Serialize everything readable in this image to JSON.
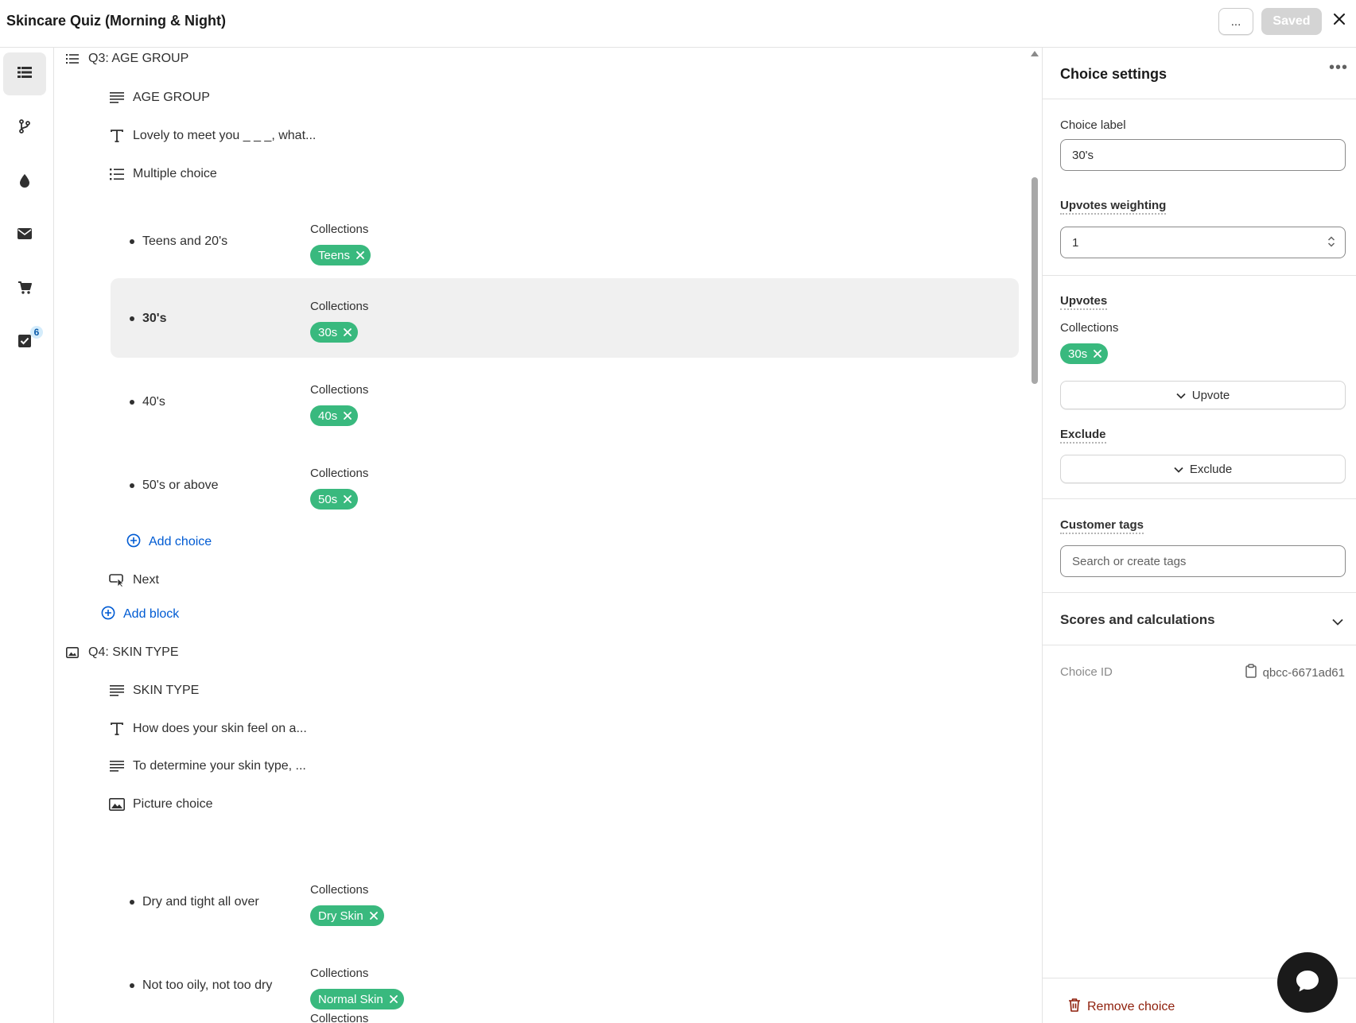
{
  "header": {
    "title": "Skincare Quiz (Morning & Night)",
    "more_label": "...",
    "saved_label": "Saved"
  },
  "rail": {
    "icons": [
      "list-icon",
      "branch-icon",
      "drop-icon",
      "mail-icon",
      "cart-icon",
      "checklist-icon"
    ],
    "badge_count": "6"
  },
  "tree": {
    "q3": {
      "title": "Q3: AGE GROUP",
      "blocks": {
        "heading": "AGE GROUP",
        "text": "Lovely to meet you _ _ _, what...",
        "multiple_choice": "Multiple choice"
      },
      "choices": [
        {
          "label": "Teens and 20's",
          "collections_label": "Collections",
          "tag": "Teens"
        },
        {
          "label": "30's",
          "collections_label": "Collections",
          "tag": "30s"
        },
        {
          "label": "40's",
          "collections_label": "Collections",
          "tag": "40s"
        },
        {
          "label": "50's or above",
          "collections_label": "Collections",
          "tag": "50s"
        }
      ],
      "add_choice": "Add choice",
      "next": "Next",
      "add_block": "Add block"
    },
    "q4": {
      "title": "Q4: SKIN TYPE",
      "blocks": {
        "heading": "SKIN TYPE",
        "text": "How does your skin feel on a...",
        "paragraph": "To determine your skin type, ...",
        "picture_choice": "Picture choice"
      },
      "choices": [
        {
          "label": "Dry and tight all over",
          "collections_label": "Collections",
          "tag": "Dry Skin"
        },
        {
          "label": "Not too oily, not too dry",
          "collections_label": "Collections",
          "tag": "Normal Skin"
        }
      ],
      "partial_collections_label": "Collections"
    }
  },
  "panel": {
    "title": "Choice settings",
    "choice_label_title": "Choice label",
    "choice_label_value": "30's",
    "upvotes_weighting_title": "Upvotes weighting",
    "upvotes_weighting_value": "1",
    "upvotes_title": "Upvotes",
    "upvotes_collections_label": "Collections",
    "upvotes_tag": "30s",
    "upvote_button": "Upvote",
    "exclude_title": "Exclude",
    "exclude_button": "Exclude",
    "customer_tags_title": "Customer tags",
    "customer_tags_placeholder": "Search or create tags",
    "scores_title": "Scores and calculations",
    "choice_id_label": "Choice ID",
    "choice_id_value": "qbcc-6671ad61",
    "remove_choice": "Remove choice"
  },
  "colors": {
    "chip_green": "#39b97e",
    "link_blue": "#005bd3",
    "danger_red": "#8e1f0b",
    "selected_row": "#f0f0f0"
  }
}
